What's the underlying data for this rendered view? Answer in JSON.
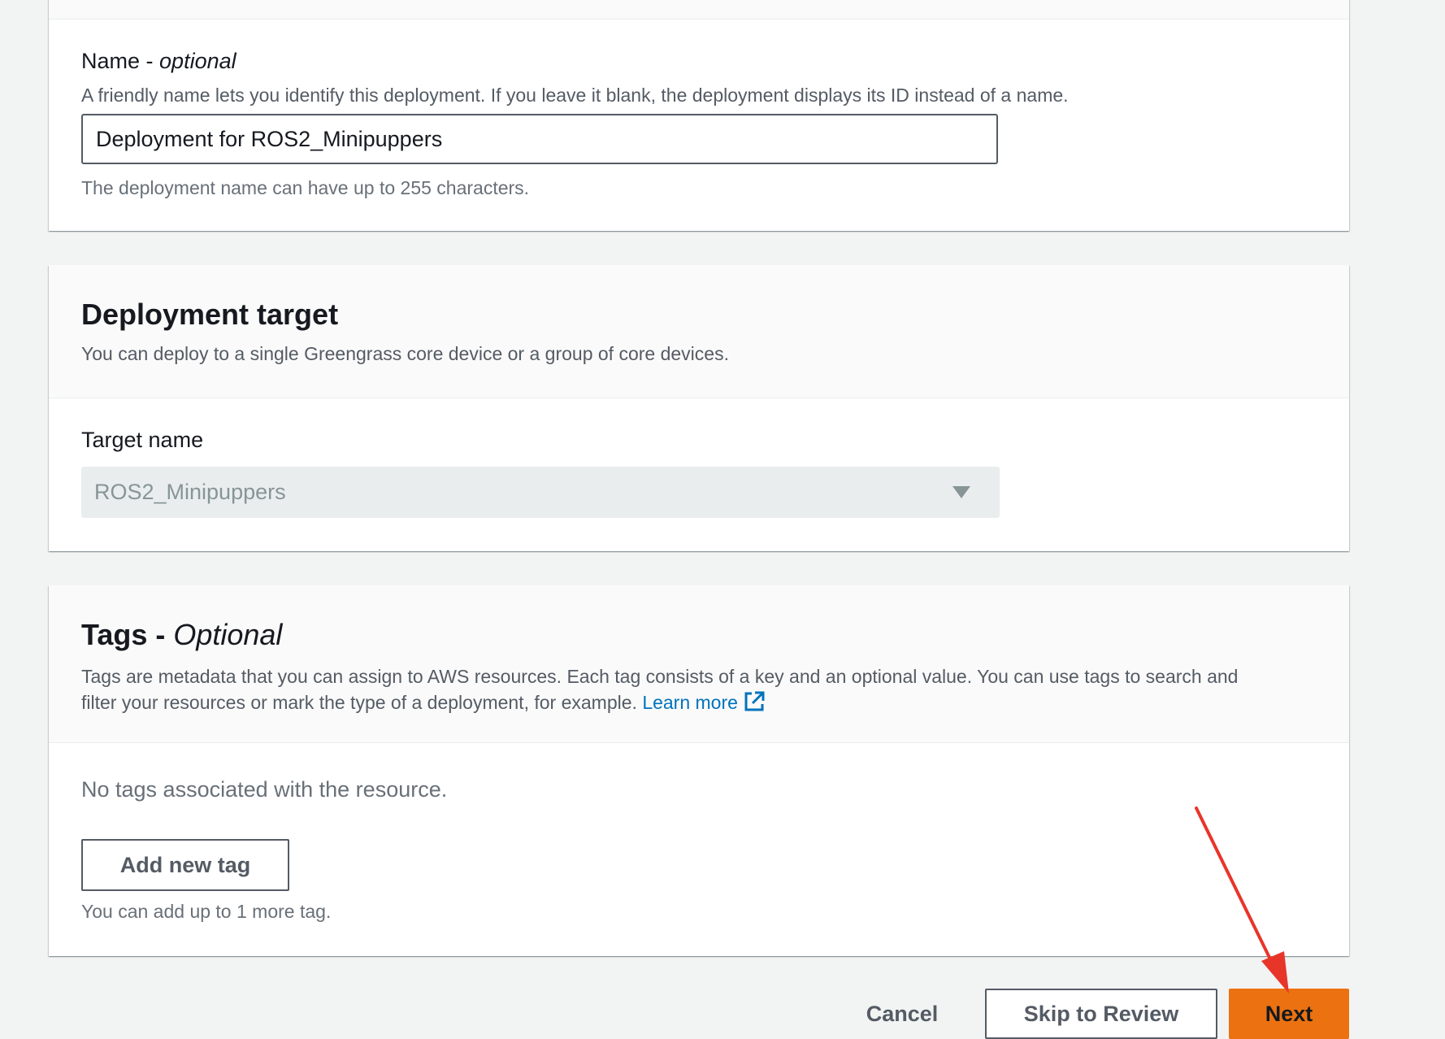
{
  "name_section": {
    "label_main": "Name - ",
    "label_optional": "optional",
    "description": "A friendly name lets you identify this deployment. If you leave it blank, the deployment displays its ID instead of a name.",
    "value": "Deployment for ROS2_Minipuppers",
    "constraint": "The deployment name can have up to 255 characters."
  },
  "target_section": {
    "title": "Deployment target",
    "description": "You can deploy to a single Greengrass core device or a group of core devices.",
    "field_label": "Target name",
    "selected_value": "ROS2_Minipuppers"
  },
  "tags_section": {
    "title_main": "Tags - ",
    "title_optional": "Optional",
    "description_line1": "Tags are metadata that you can assign to AWS resources. Each tag consists of a key and an optional value. You can use tags to search and",
    "description_line2": "filter your resources or mark the type of a deployment, for example.",
    "learn_more": "Learn more",
    "empty_text": "No tags associated with the resource.",
    "add_button": "Add new tag",
    "limit_text": "You can add up to 1 more tag."
  },
  "footer": {
    "cancel": "Cancel",
    "skip": "Skip to Review",
    "next": "Next"
  },
  "colors": {
    "primary_button": "#ec7211",
    "link": "#0073bb",
    "annotation_arrow": "#e8352a"
  },
  "icons": [
    "external-link-icon",
    "caret-down-icon",
    "annotation-arrow"
  ]
}
